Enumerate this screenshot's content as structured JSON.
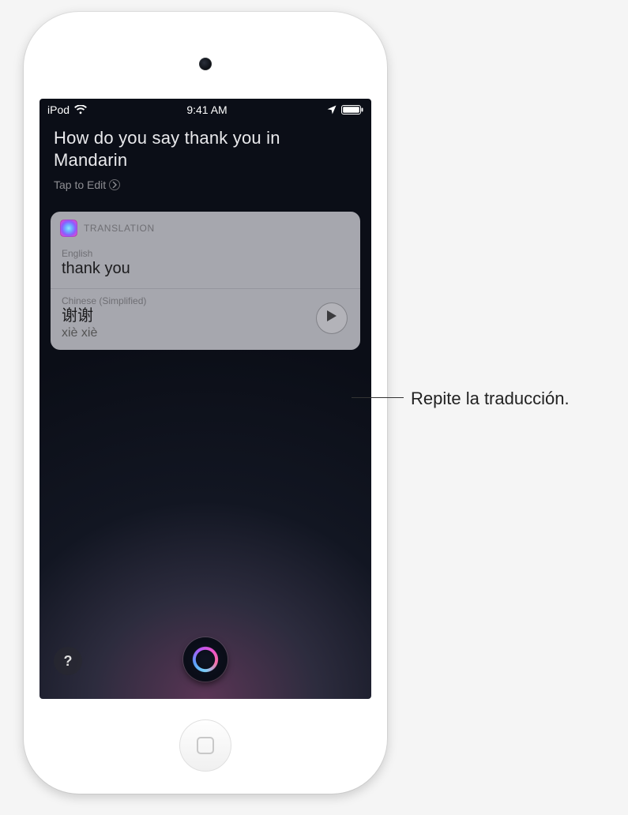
{
  "statusBar": {
    "carrier": "iPod",
    "time": "9:41 AM"
  },
  "siri": {
    "query": "How do you say thank you in Mandarin",
    "tapToEdit": "Tap to Edit"
  },
  "card": {
    "title": "TRANSLATION",
    "source": {
      "label": "English",
      "value": "thank you"
    },
    "target": {
      "label": "Chinese (Simplified)",
      "value": "谢谢",
      "romanization": "xiè xiè"
    }
  },
  "callout": {
    "text": "Repite la traducción."
  }
}
